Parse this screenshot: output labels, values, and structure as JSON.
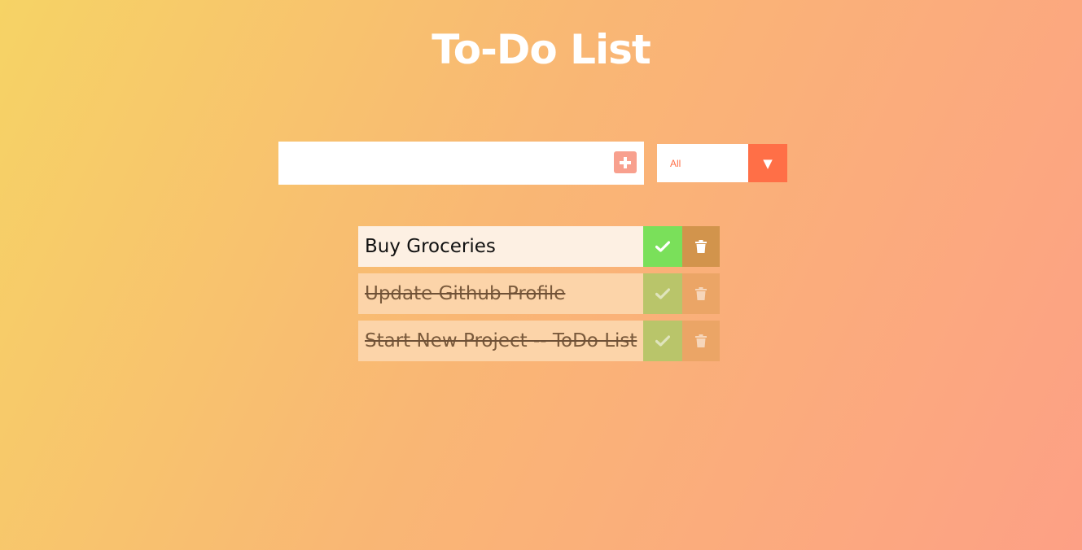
{
  "app": {
    "title": "To-Do List"
  },
  "input": {
    "value": "",
    "placeholder": "",
    "add_icon": "plus-square-icon"
  },
  "filter": {
    "selected": "All",
    "arrow": "▼"
  },
  "todos": [
    {
      "text": "Buy Groceries",
      "completed": false
    },
    {
      "text": "Update Github Profile",
      "completed": true
    },
    {
      "text": "Start New Project -- ToDo List",
      "completed": true
    }
  ],
  "colors": {
    "gradient_start": "#f6d365",
    "gradient_end": "#fda085",
    "accent": "#ff6f47",
    "check": "#7ae05a",
    "trash": "#d2944c",
    "add_button": "#f8a08e"
  }
}
